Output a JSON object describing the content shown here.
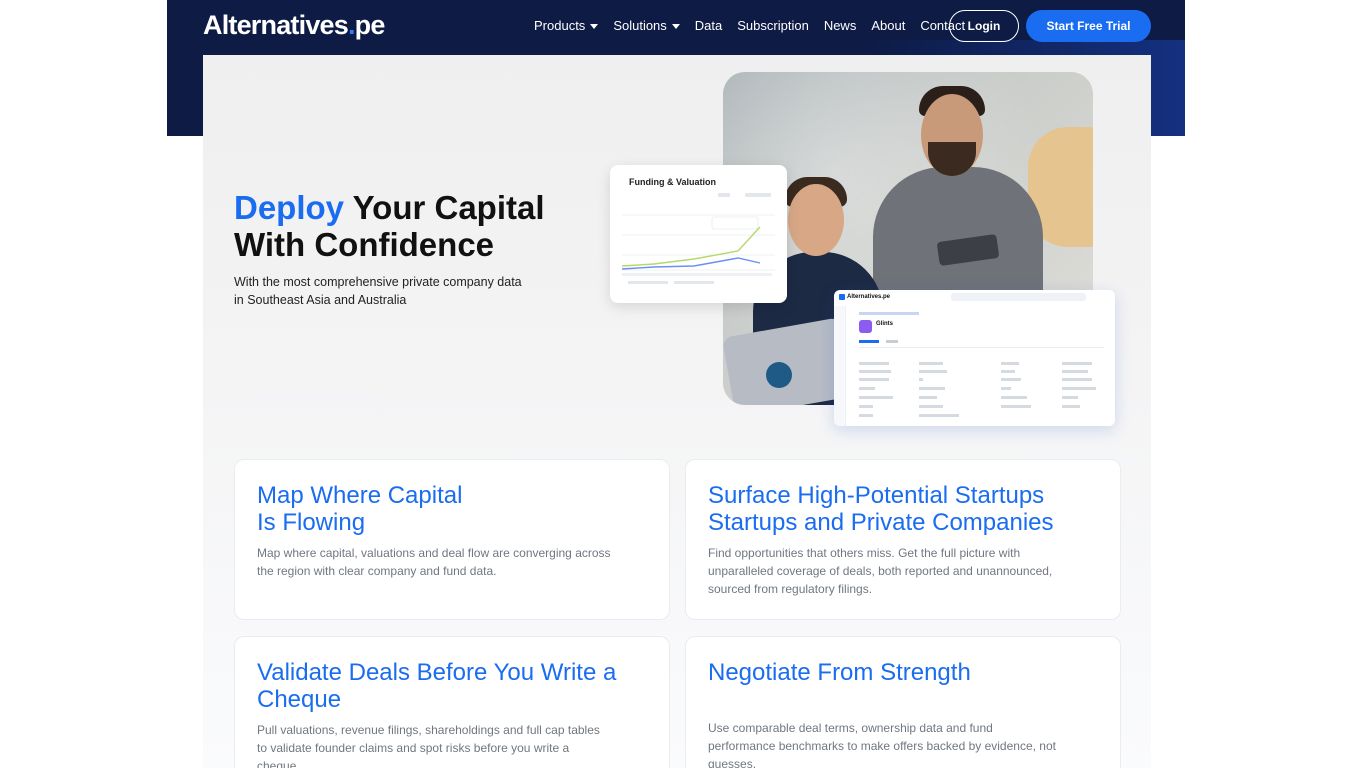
{
  "header": {
    "logo_text": "Alternatives",
    "logo_dot": ".",
    "logo_suffix": "pe",
    "nav": [
      {
        "label": "Products",
        "has_caret": true
      },
      {
        "label": "Solutions",
        "has_caret": true
      },
      {
        "label": "Data",
        "has_caret": false
      },
      {
        "label": "Subscription",
        "has_caret": false
      },
      {
        "label": "News",
        "has_caret": false
      },
      {
        "label": "About",
        "has_caret": false
      },
      {
        "label": "Contact",
        "has_caret": false
      }
    ],
    "login_label": "Login",
    "trial_label": "Start Free Trial"
  },
  "hero": {
    "title_accent": "Deploy",
    "title_rest_1": " Your Capital",
    "title_line_2": "With Confidence",
    "subtitle_line_1": "With the most comprehensive private company data",
    "subtitle_line_2": "in Southeast Asia and Australia"
  },
  "funding_card": {
    "title": "Funding & Valuation"
  },
  "company_card": {
    "brand": "Alternatives.pe",
    "company_name": "Glints"
  },
  "features": [
    {
      "title_line_1": "Map Where Capital",
      "title_line_2": "Is Flowing",
      "body_line_1": "Map where capital, valuations and deal flow are converging across",
      "body_line_2": "the region with clear company and fund data.",
      "body_line_3": ""
    },
    {
      "title_line_1": "Surface High-Potential Startups",
      "title_line_2": "Startups and Private Companies",
      "body_line_1": "Find opportunities that others miss. Get the full picture with",
      "body_line_2": "unparalleled coverage of deals, both reported and unannounced,",
      "body_line_3": "sourced from regulatory filings."
    },
    {
      "title_line_1": "Validate Deals Before You Write a",
      "title_line_2": "Cheque",
      "body_line_1": "Pull valuations, revenue filings, shareholdings and full cap tables",
      "body_line_2": "to validate founder claims and spot risks before you write a",
      "body_line_3": "cheque."
    },
    {
      "title_line_1": "Negotiate From Strength",
      "title_line_2": "",
      "body_line_1": "Use comparable deal terms, ownership data and fund",
      "body_line_2": "performance benchmarks to make offers backed by evidence, not",
      "body_line_3": "guesses."
    }
  ],
  "colors": {
    "navy": "#0d1b45",
    "accent": "#1a6cf0",
    "body_text": "#707780"
  }
}
